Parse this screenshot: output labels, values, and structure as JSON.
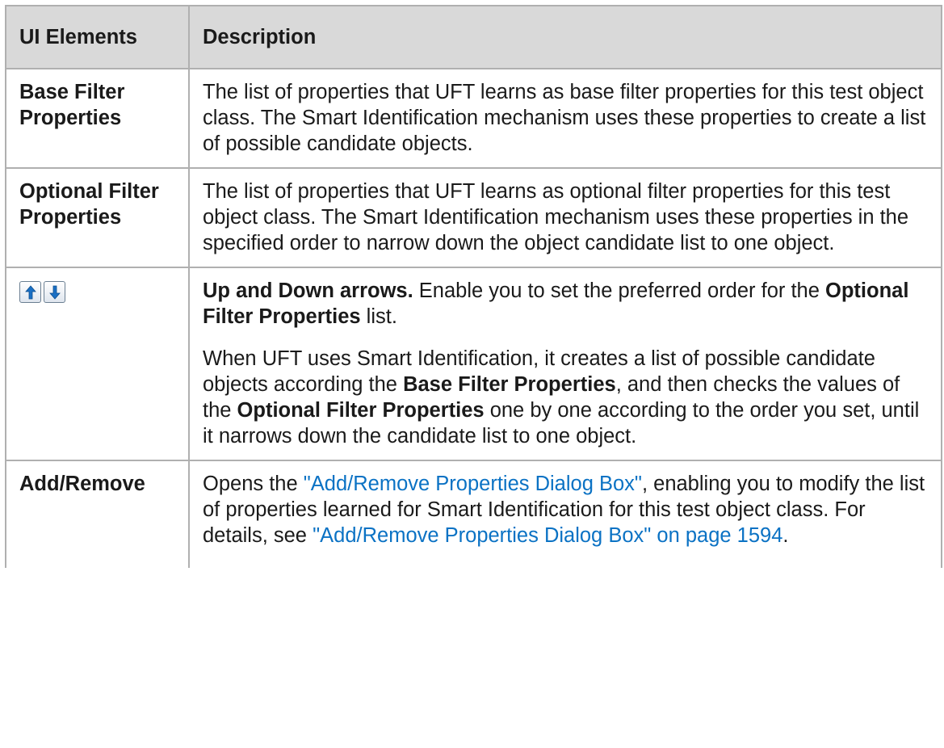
{
  "table": {
    "headers": [
      "UI Elements",
      "Description"
    ],
    "rows": {
      "base": {
        "element": "Base Filter Properties",
        "description": "The list of properties that UFT learns as base filter properties for this test object class. The Smart Identification mechanism uses these properties to create a list of possible candidate objects."
      },
      "optional": {
        "element": "Optional Filter Properties",
        "description": "The list of properties that UFT learns as optional filter properties for this test object class. The Smart Identification mechanism uses these properties in the specified order to narrow down the object candidate list to one object."
      },
      "arrows": {
        "icons": [
          "up-arrow-icon",
          "down-arrow-icon"
        ],
        "p1_bold": "Up and Down arrows.",
        "p1_text": " Enable you to set the preferred order for the ",
        "p1_bold2": "Optional Filter Properties",
        "p1_text2": " list.",
        "p2_text1": "When UFT uses Smart Identification, it creates a list of possible candidate objects according the ",
        "p2_bold1": "Base Filter Properties",
        "p2_text2": ", and then checks the values of the ",
        "p2_bold2": "Optional Filter Properties",
        "p2_text3": " one by one according to the order you set, until it narrows down the candidate list to one object."
      },
      "add_remove": {
        "element": "Add/Remove",
        "text1": "Opens the ",
        "link1": "\"Add/Remove Properties Dialog Box\"",
        "text2": ", enabling you to modify the list of properties learned for Smart Identification for this test object class. For details, see ",
        "link2": "\"Add/Remove Properties Dialog Box\" on page 1594",
        "text3": "."
      }
    }
  },
  "colors": {
    "link": "#0b72c4",
    "header_bg": "#d9d9d9",
    "border": "#b0b0b0",
    "arrow": "#1a6fc4"
  }
}
